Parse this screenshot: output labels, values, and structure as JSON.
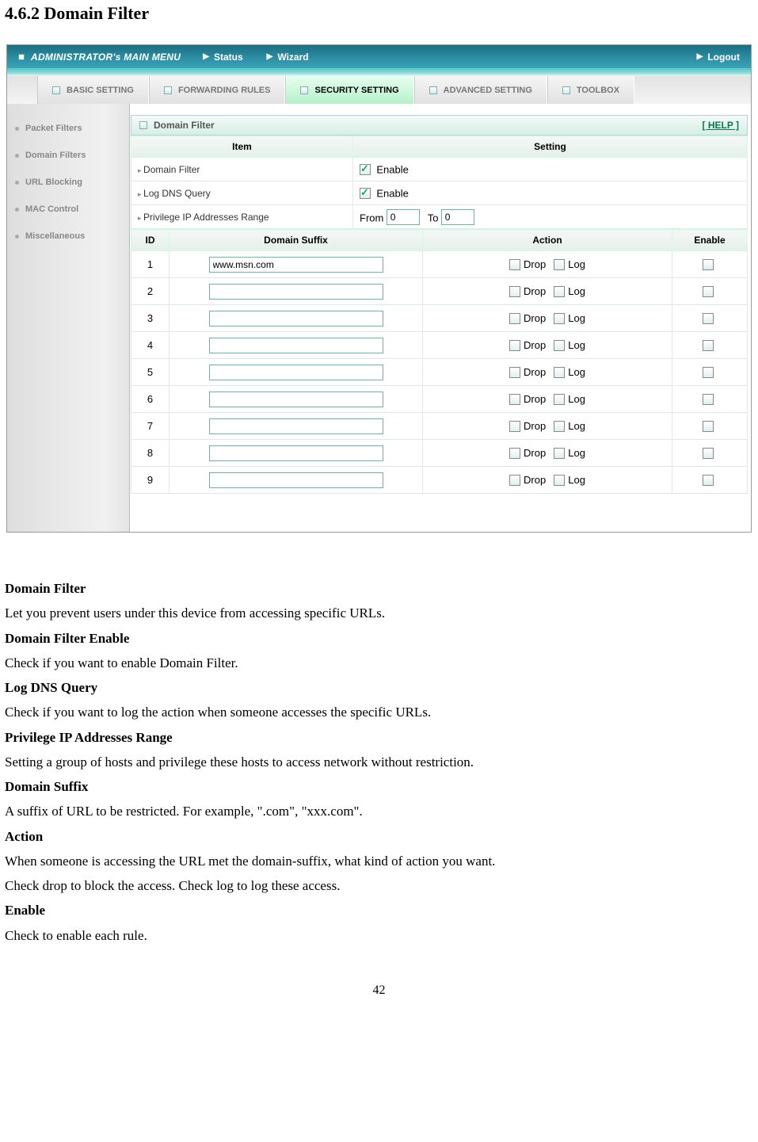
{
  "doc": {
    "heading": "4.6.2 Domain Filter",
    "page_number": "42",
    "paragraphs": [
      {
        "bold": true,
        "text": "Domain Filter"
      },
      {
        "bold": false,
        "text": "Let you prevent users under this device from accessing specific URLs."
      },
      {
        "bold": true,
        "text": "Domain Filter Enable"
      },
      {
        "bold": false,
        "text": "Check if you want to enable Domain Filter."
      },
      {
        "bold": true,
        "text": "Log DNS Query"
      },
      {
        "bold": false,
        "text": "Check if you want to log the action when someone accesses the specific URLs."
      },
      {
        "bold": true,
        "text": "Privilege IP Addresses Range"
      },
      {
        "bold": false,
        "text": "Setting a group of hosts and privilege these hosts to access network without restriction."
      },
      {
        "bold": true,
        "text": "Domain Suffix"
      },
      {
        "bold": false,
        "text": "A suffix of URL to be restricted. For example, \".com\", \"xxx.com\"."
      },
      {
        "bold": true,
        "text": "Action"
      },
      {
        "bold": false,
        "text": "When someone is accessing the URL met the domain-suffix, what kind of action you want."
      },
      {
        "bold": false,
        "text": "Check drop to block the access. Check log to log these access."
      },
      {
        "bold": true,
        "text": "Enable"
      },
      {
        "bold": false,
        "text": "Check to enable each rule."
      }
    ]
  },
  "topbar": {
    "main_menu": "ADMINISTRATOR's MAIN MENU",
    "status": "Status",
    "wizard": "Wizard",
    "logout": "Logout"
  },
  "tabs": [
    {
      "label": "BASIC SETTING",
      "active": false
    },
    {
      "label": "FORWARDING RULES",
      "active": false
    },
    {
      "label": "SECURITY SETTING",
      "active": true
    },
    {
      "label": "ADVANCED SETTING",
      "active": false
    },
    {
      "label": "TOOLBOX",
      "active": false
    }
  ],
  "sidebar": [
    "Packet Filters",
    "Domain Filters",
    "URL Blocking",
    "MAC Control",
    "Miscellaneous"
  ],
  "panel": {
    "title": "Domain Filter",
    "help": "[ HELP ]",
    "headers": {
      "item": "Item",
      "setting": "Setting"
    },
    "rows": {
      "domain_filter": {
        "label": "Domain Filter",
        "enable_label": "Enable",
        "checked": true
      },
      "log_dns": {
        "label": "Log DNS Query",
        "enable_label": "Enable",
        "checked": true
      },
      "priv_range": {
        "label": "Privilege IP Addresses Range",
        "from_label": "From",
        "to_label": "To",
        "from": "0",
        "to": "0"
      }
    },
    "rules_headers": {
      "id": "ID",
      "suffix": "Domain Suffix",
      "action": "Action",
      "enable": "Enable"
    },
    "action_labels": {
      "drop": "Drop",
      "log": "Log"
    },
    "rules": [
      {
        "id": "1",
        "suffix": "www.msn.com"
      },
      {
        "id": "2",
        "suffix": ""
      },
      {
        "id": "3",
        "suffix": ""
      },
      {
        "id": "4",
        "suffix": ""
      },
      {
        "id": "5",
        "suffix": ""
      },
      {
        "id": "6",
        "suffix": ""
      },
      {
        "id": "7",
        "suffix": ""
      },
      {
        "id": "8",
        "suffix": ""
      },
      {
        "id": "9",
        "suffix": ""
      }
    ]
  }
}
